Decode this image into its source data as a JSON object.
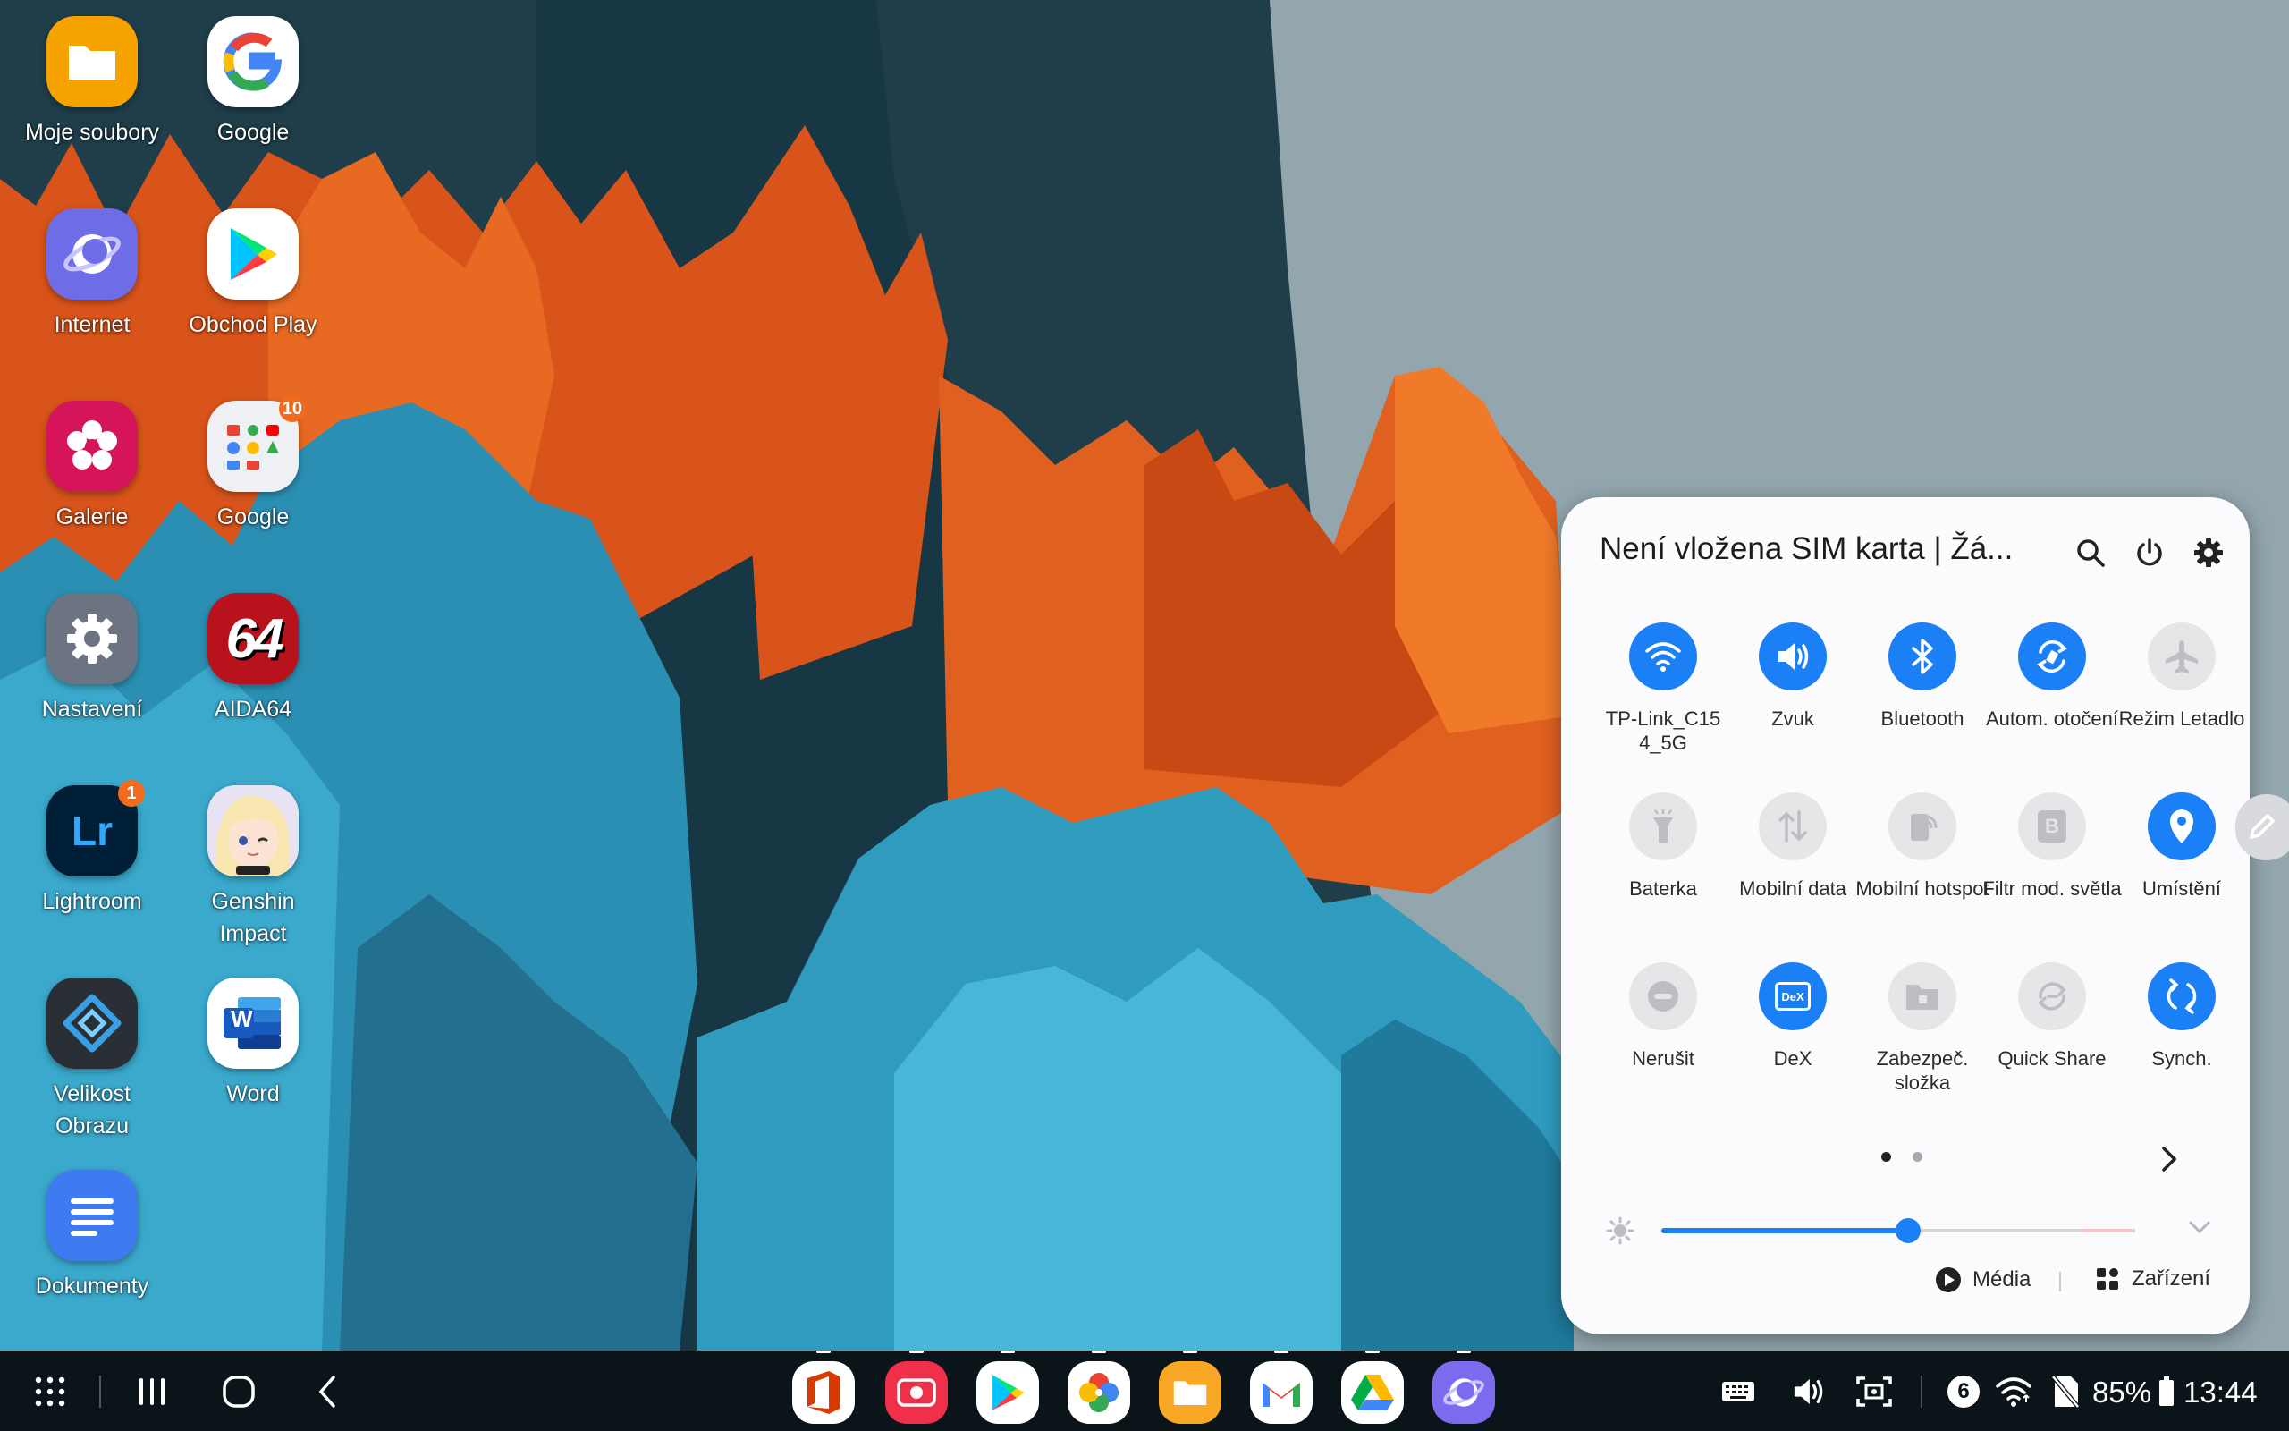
{
  "desktop": {
    "icons": [
      {
        "label": "Moje soubory",
        "icon": "folder-icon"
      },
      {
        "label": "Google",
        "icon": "google-g-icon"
      },
      {
        "label": "Internet",
        "icon": "samsung-internet-icon"
      },
      {
        "label": "Obchod Play",
        "icon": "play-store-icon"
      },
      {
        "label": "Galerie",
        "icon": "gallery-flower-icon"
      },
      {
        "label": "Google",
        "icon": "google-folder-icon",
        "badge": "10"
      },
      {
        "label": "Nastavení",
        "icon": "settings-gear-icon"
      },
      {
        "label": "AIDA64",
        "icon": "aida64-icon",
        "glyph": "64"
      },
      {
        "label": "Lightroom",
        "icon": "lightroom-icon",
        "glyph": "Lr",
        "badge": "1"
      },
      {
        "label": "Genshin Impact",
        "icon": "genshin-impact-icon"
      },
      {
        "label": "Velikost Obrazu",
        "icon": "image-size-icon"
      },
      {
        "label": "Word",
        "icon": "word-icon",
        "glyph": "W"
      },
      {
        "label": "Dokumenty",
        "icon": "documents-icon"
      }
    ]
  },
  "quick_panel": {
    "title": "Není vložena SIM karta | Žá...",
    "tiles": [
      {
        "label": "TP-Link_C15 4_5G",
        "icon": "wifi-icon",
        "on": true
      },
      {
        "label": "Zvuk",
        "icon": "sound-icon",
        "on": true
      },
      {
        "label": "Bluetooth",
        "icon": "bluetooth-icon",
        "on": true
      },
      {
        "label": "Autom. otočení",
        "icon": "auto-rotate-icon",
        "on": true
      },
      {
        "label": "Režim Letadlo",
        "icon": "airplane-icon",
        "on": false
      },
      {
        "label": "Baterka",
        "icon": "flashlight-icon",
        "on": false
      },
      {
        "label": "Mobilní data",
        "icon": "mobile-data-icon",
        "on": false
      },
      {
        "label": "Mobilní hotspot",
        "icon": "hotspot-icon",
        "on": false
      },
      {
        "label": "Filtr mod. světla",
        "icon": "blue-light-filter-icon",
        "glyph": "B",
        "on": false
      },
      {
        "label": "Umístění",
        "icon": "location-icon",
        "on": true
      },
      {
        "label": "Nerušit",
        "icon": "do-not-disturb-icon",
        "on": false
      },
      {
        "label": "DeX",
        "icon": "dex-icon",
        "glyph": "DeX",
        "on": true
      },
      {
        "label": "Zabezpeč. složka",
        "icon": "secure-folder-icon",
        "on": false
      },
      {
        "label": "Quick Share",
        "icon": "quick-share-icon",
        "on": false
      },
      {
        "label": "Synch.",
        "icon": "sync-icon",
        "on": true
      }
    ],
    "page_indicator": {
      "pages": 2,
      "current": 1
    },
    "brightness": 0.52,
    "media_label": "Média",
    "devices_label": "Zařízení"
  },
  "taskbar": {
    "apps": [
      {
        "name": "office-app-icon",
        "color": "#ffffff"
      },
      {
        "name": "screen-recorder-app-icon",
        "color": "#f0304a"
      },
      {
        "name": "play-store-app-icon",
        "color": "#ffffff"
      },
      {
        "name": "google-photos-app-icon",
        "color": "#ffffff"
      },
      {
        "name": "my-files-app-icon",
        "color": "#f9a825"
      },
      {
        "name": "gmail-app-icon",
        "color": "#ffffff"
      },
      {
        "name": "google-drive-app-icon",
        "color": "#ffffff"
      },
      {
        "name": "samsung-internet-app-icon",
        "color": "#7d6bef"
      }
    ],
    "notification_count": "6",
    "battery": "85%",
    "time": "13:44"
  },
  "colors": {
    "accent": "#1b7ff5",
    "tile_off": "#e6e6e9",
    "panel": "#fbfbfd",
    "taskbar": "#0a1419",
    "badge": "#f26b1d"
  }
}
